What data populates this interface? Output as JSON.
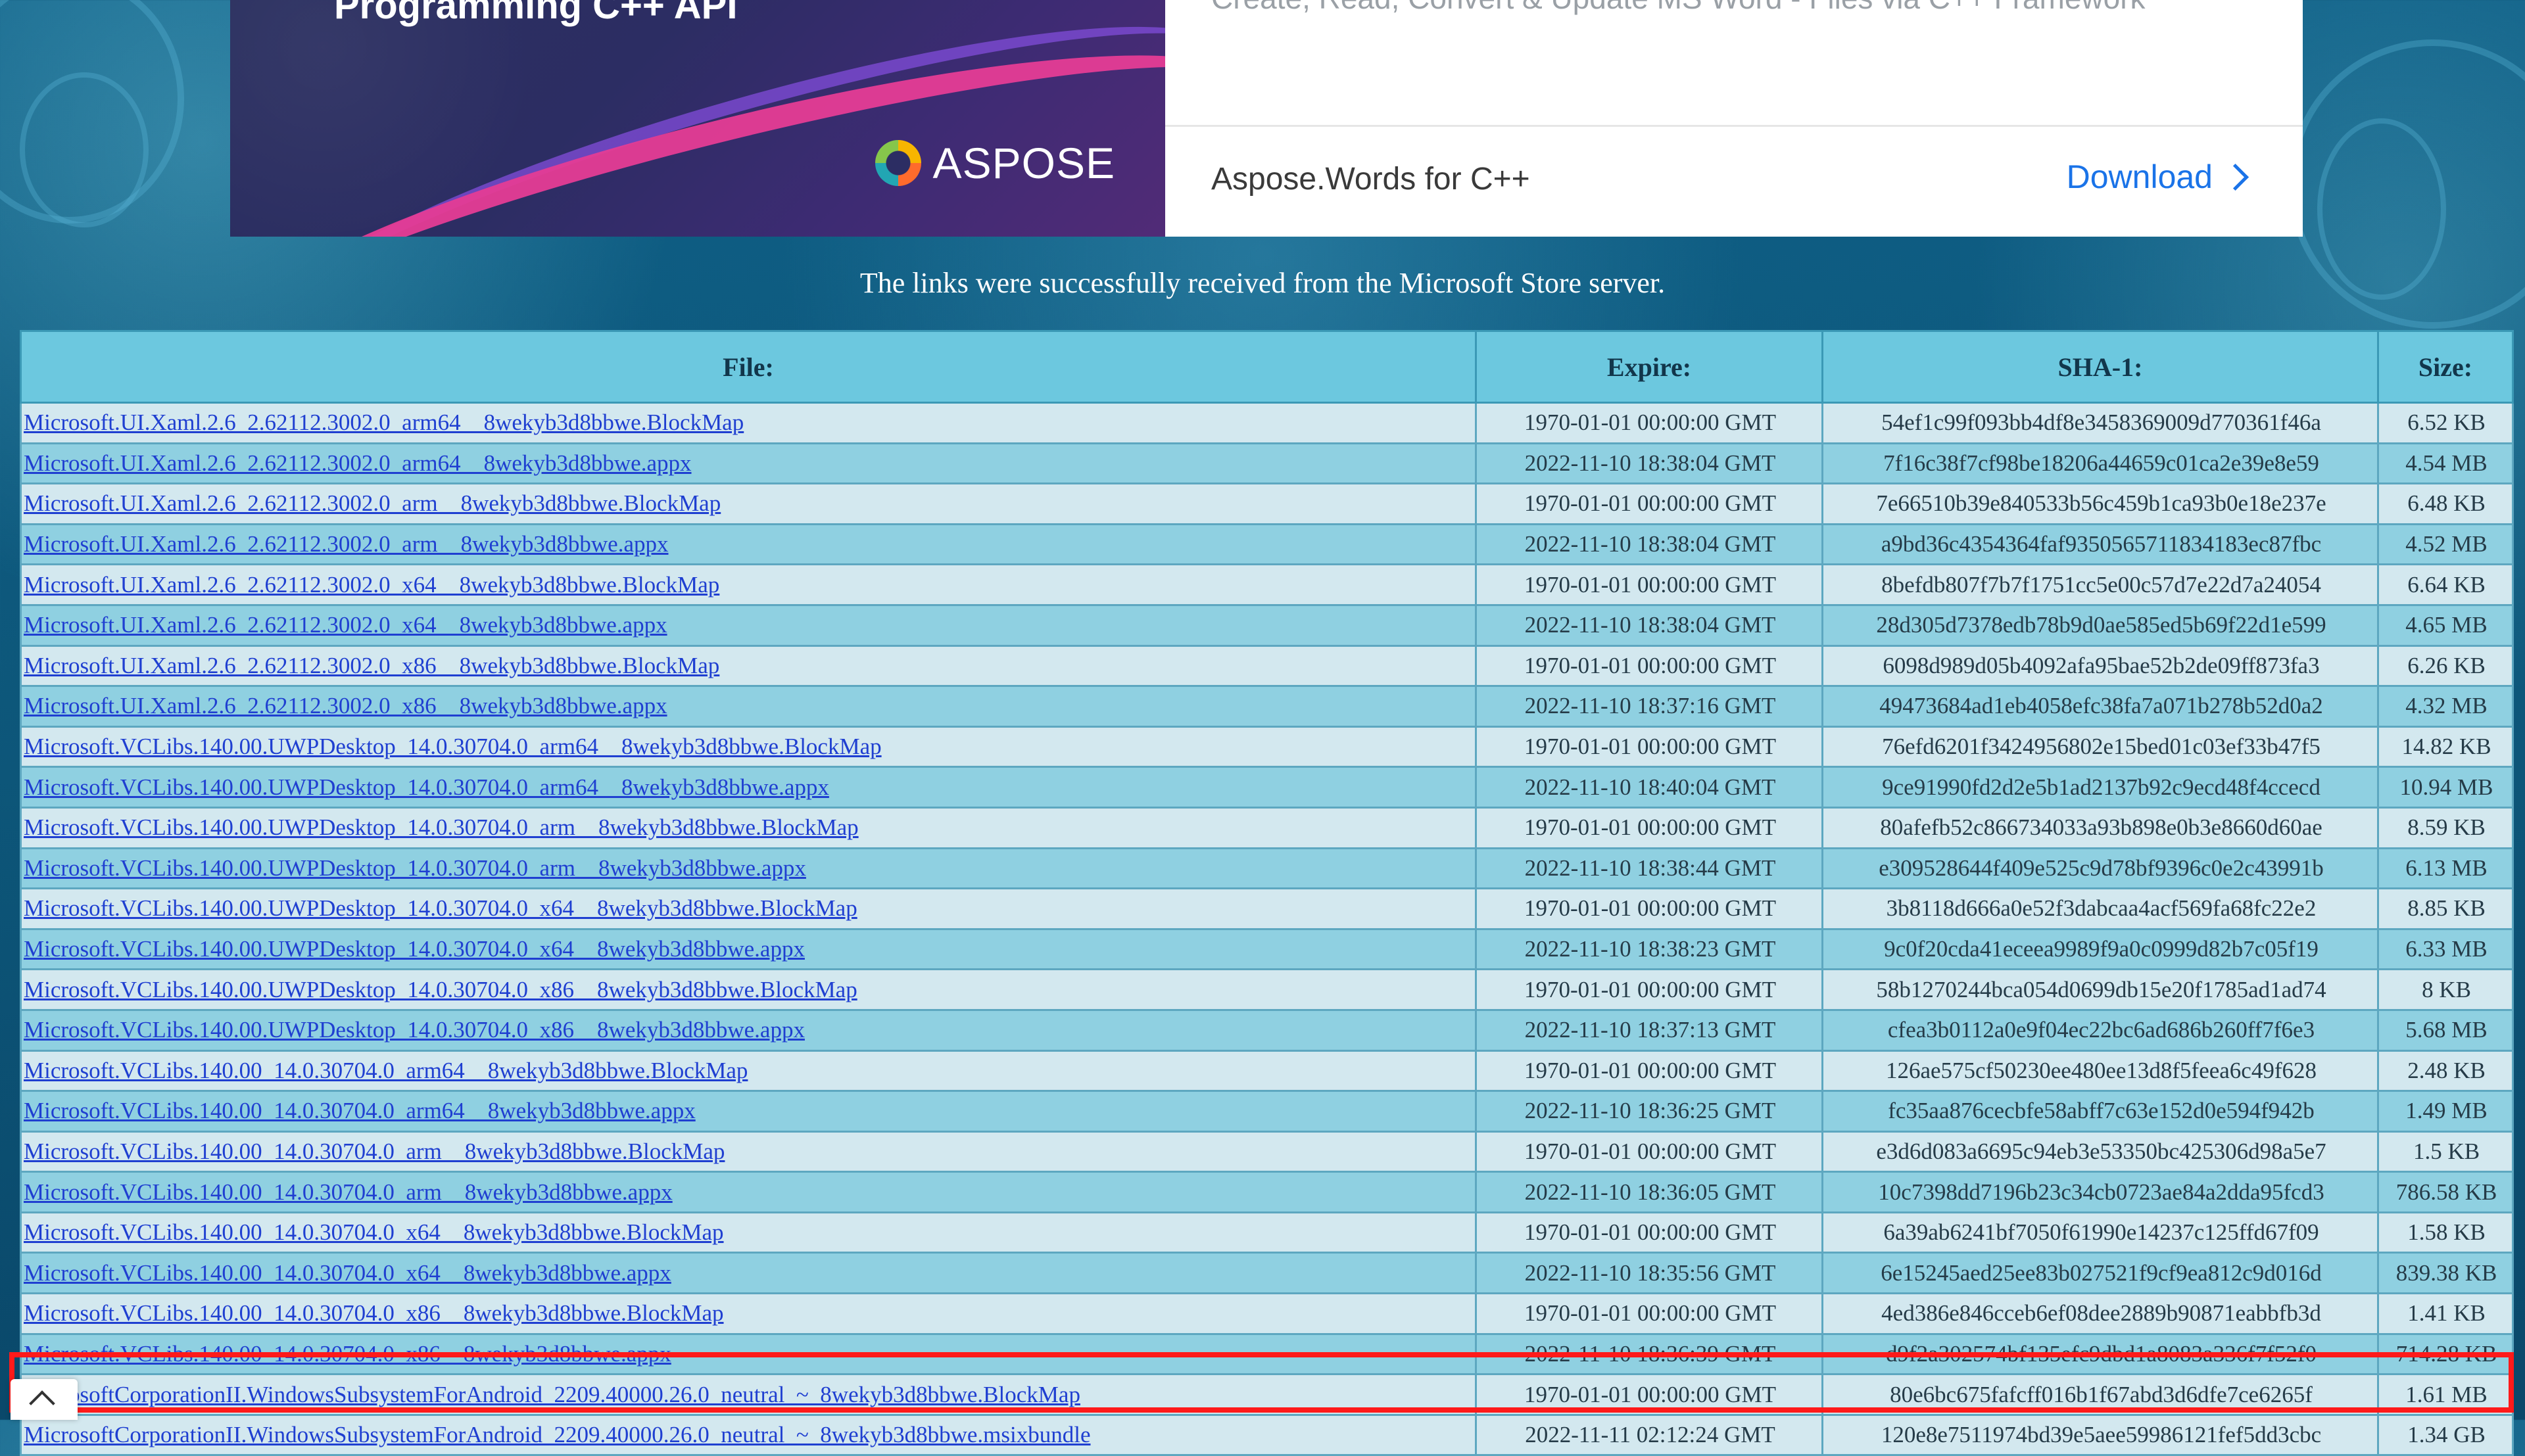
{
  "ad": {
    "title": "Programming C++ API",
    "subtext": "Create, Read, Convert & Update MS Word - Files via C++ Framework",
    "logo_text": "ASPOSE",
    "product": "Aspose.Words for C++",
    "download_label": "Download"
  },
  "notice": "The links were successfully received from the Microsoft Store server.",
  "table": {
    "headers": [
      "File:",
      "Expire:",
      "SHA-1:",
      "Size:"
    ],
    "rows": [
      {
        "file": "Microsoft.UI.Xaml.2.6_2.62112.3002.0_arm64__8wekyb3d8bbwe.BlockMap",
        "expire": "1970-01-01 00:00:00 GMT",
        "sha1": "54ef1c99f093bb4df8e3458369009d770361f46a",
        "size": "6.52 KB"
      },
      {
        "file": "Microsoft.UI.Xaml.2.6_2.62112.3002.0_arm64__8wekyb3d8bbwe.appx",
        "expire": "2022-11-10 18:38:04 GMT",
        "sha1": "7f16c38f7cf98be18206a44659c01ca2e39e8e59",
        "size": "4.54 MB"
      },
      {
        "file": "Microsoft.UI.Xaml.2.6_2.62112.3002.0_arm__8wekyb3d8bbwe.BlockMap",
        "expire": "1970-01-01 00:00:00 GMT",
        "sha1": "7e66510b39e840533b56c459b1ca93b0e18e237e",
        "size": "6.48 KB"
      },
      {
        "file": "Microsoft.UI.Xaml.2.6_2.62112.3002.0_arm__8wekyb3d8bbwe.appx",
        "expire": "2022-11-10 18:38:04 GMT",
        "sha1": "a9bd36c4354364faf9350565711834183ec87fbc",
        "size": "4.52 MB"
      },
      {
        "file": "Microsoft.UI.Xaml.2.6_2.62112.3002.0_x64__8wekyb3d8bbwe.BlockMap",
        "expire": "1970-01-01 00:00:00 GMT",
        "sha1": "8befdb807f7b7f1751cc5e00c57d7e22d7a24054",
        "size": "6.64 KB"
      },
      {
        "file": "Microsoft.UI.Xaml.2.6_2.62112.3002.0_x64__8wekyb3d8bbwe.appx",
        "expire": "2022-11-10 18:38:04 GMT",
        "sha1": "28d305d7378edb78b9d0ae585ed5b69f22d1e599",
        "size": "4.65 MB"
      },
      {
        "file": "Microsoft.UI.Xaml.2.6_2.62112.3002.0_x86__8wekyb3d8bbwe.BlockMap",
        "expire": "1970-01-01 00:00:00 GMT",
        "sha1": "6098d989d05b4092afa95bae52b2de09ff873fa3",
        "size": "6.26 KB"
      },
      {
        "file": "Microsoft.UI.Xaml.2.6_2.62112.3002.0_x86__8wekyb3d8bbwe.appx",
        "expire": "2022-11-10 18:37:16 GMT",
        "sha1": "49473684ad1eb4058efc38fa7a071b278b52d0a2",
        "size": "4.32 MB"
      },
      {
        "file": "Microsoft.VCLibs.140.00.UWPDesktop_14.0.30704.0_arm64__8wekyb3d8bbwe.BlockMap",
        "expire": "1970-01-01 00:00:00 GMT",
        "sha1": "76efd6201f3424956802e15bed01c03ef33b47f5",
        "size": "14.82 KB"
      },
      {
        "file": "Microsoft.VCLibs.140.00.UWPDesktop_14.0.30704.0_arm64__8wekyb3d8bbwe.appx",
        "expire": "2022-11-10 18:40:04 GMT",
        "sha1": "9ce91990fd2d2e5b1ad2137b92c9ecd48f4ccecd",
        "size": "10.94 MB"
      },
      {
        "file": "Microsoft.VCLibs.140.00.UWPDesktop_14.0.30704.0_arm__8wekyb3d8bbwe.BlockMap",
        "expire": "1970-01-01 00:00:00 GMT",
        "sha1": "80afefb52c866734033a93b898e0b3e8660d60ae",
        "size": "8.59 KB"
      },
      {
        "file": "Microsoft.VCLibs.140.00.UWPDesktop_14.0.30704.0_arm__8wekyb3d8bbwe.appx",
        "expire": "2022-11-10 18:38:44 GMT",
        "sha1": "e309528644f409e525c9d78bf9396c0e2c43991b",
        "size": "6.13 MB"
      },
      {
        "file": "Microsoft.VCLibs.140.00.UWPDesktop_14.0.30704.0_x64__8wekyb3d8bbwe.BlockMap",
        "expire": "1970-01-01 00:00:00 GMT",
        "sha1": "3b8118d666a0e52f3dabcaa4acf569fa68fc22e2",
        "size": "8.85 KB"
      },
      {
        "file": "Microsoft.VCLibs.140.00.UWPDesktop_14.0.30704.0_x64__8wekyb3d8bbwe.appx",
        "expire": "2022-11-10 18:38:23 GMT",
        "sha1": "9c0f20cda41eceea9989f9a0c0999d82b7c05f19",
        "size": "6.33 MB"
      },
      {
        "file": "Microsoft.VCLibs.140.00.UWPDesktop_14.0.30704.0_x86__8wekyb3d8bbwe.BlockMap",
        "expire": "1970-01-01 00:00:00 GMT",
        "sha1": "58b1270244bca054d0699db15e20f1785ad1ad74",
        "size": "8 KB"
      },
      {
        "file": "Microsoft.VCLibs.140.00.UWPDesktop_14.0.30704.0_x86__8wekyb3d8bbwe.appx",
        "expire": "2022-11-10 18:37:13 GMT",
        "sha1": "cfea3b0112a0e9f04ec22bc6ad686b260ff7f6e3",
        "size": "5.68 MB"
      },
      {
        "file": "Microsoft.VCLibs.140.00_14.0.30704.0_arm64__8wekyb3d8bbwe.BlockMap",
        "expire": "1970-01-01 00:00:00 GMT",
        "sha1": "126ae575cf50230ee480ee13d8f5feea6c49f628",
        "size": "2.48 KB"
      },
      {
        "file": "Microsoft.VCLibs.140.00_14.0.30704.0_arm64__8wekyb3d8bbwe.appx",
        "expire": "2022-11-10 18:36:25 GMT",
        "sha1": "fc35aa876cecbfe58abff7c63e152d0e594f942b",
        "size": "1.49 MB"
      },
      {
        "file": "Microsoft.VCLibs.140.00_14.0.30704.0_arm__8wekyb3d8bbwe.BlockMap",
        "expire": "1970-01-01 00:00:00 GMT",
        "sha1": "e3d6d083a6695c94eb3e53350bc425306d98a5e7",
        "size": "1.5 KB"
      },
      {
        "file": "Microsoft.VCLibs.140.00_14.0.30704.0_arm__8wekyb3d8bbwe.appx",
        "expire": "2022-11-10 18:36:05 GMT",
        "sha1": "10c7398dd7196b23c34cb0723ae84a2dda95fcd3",
        "size": "786.58 KB"
      },
      {
        "file": "Microsoft.VCLibs.140.00_14.0.30704.0_x64__8wekyb3d8bbwe.BlockMap",
        "expire": "1970-01-01 00:00:00 GMT",
        "sha1": "6a39ab6241bf7050f61990e14237c125ffd67f09",
        "size": "1.58 KB"
      },
      {
        "file": "Microsoft.VCLibs.140.00_14.0.30704.0_x64__8wekyb3d8bbwe.appx",
        "expire": "2022-11-10 18:35:56 GMT",
        "sha1": "6e15245aed25ee83b027521f9cf9ea812c9d016d",
        "size": "839.38 KB"
      },
      {
        "file": "Microsoft.VCLibs.140.00_14.0.30704.0_x86__8wekyb3d8bbwe.BlockMap",
        "expire": "1970-01-01 00:00:00 GMT",
        "sha1": "4ed386e846cceb6ef08dee2889b90871eabbfb3d",
        "size": "1.41 KB"
      },
      {
        "file": "Microsoft.VCLibs.140.00_14.0.30704.0_x86__8wekyb3d8bbwe.appx",
        "expire": "2022-11-10 18:36:39 GMT",
        "sha1": "d9f2a302574bf135efc9dbd1a8083a336f7f52f0",
        "size": "714.28 KB"
      },
      {
        "file": "MicrosoftCorporationII.WindowsSubsystemForAndroid_2209.40000.26.0_neutral_~_8wekyb3d8bbwe.BlockMap",
        "expire": "1970-01-01 00:00:00 GMT",
        "sha1": "80e6bc675fafcff016b1f67abd3d6dfe7ce6265f",
        "size": "1.61 MB"
      },
      {
        "file": "MicrosoftCorporationII.WindowsSubsystemForAndroid_2209.40000.26.0_neutral_~_8wekyb3d8bbwe.msixbundle",
        "expire": "2022-11-11 02:12:24 GMT",
        "sha1": "120e8e7511974bd39e5aee59986121fef5dd3cbc",
        "size": "1.34 GB"
      }
    ]
  },
  "icons": {
    "download_chevron": "chevron-right-icon",
    "scroll_top": "chevron-up-icon"
  },
  "colors": {
    "link": "#1f3fd1",
    "highlight_border": "#ff1a1a",
    "header_bg": "#6cc8df",
    "row_light": "#d3e8ef",
    "row_dark": "#8fd0e1"
  }
}
